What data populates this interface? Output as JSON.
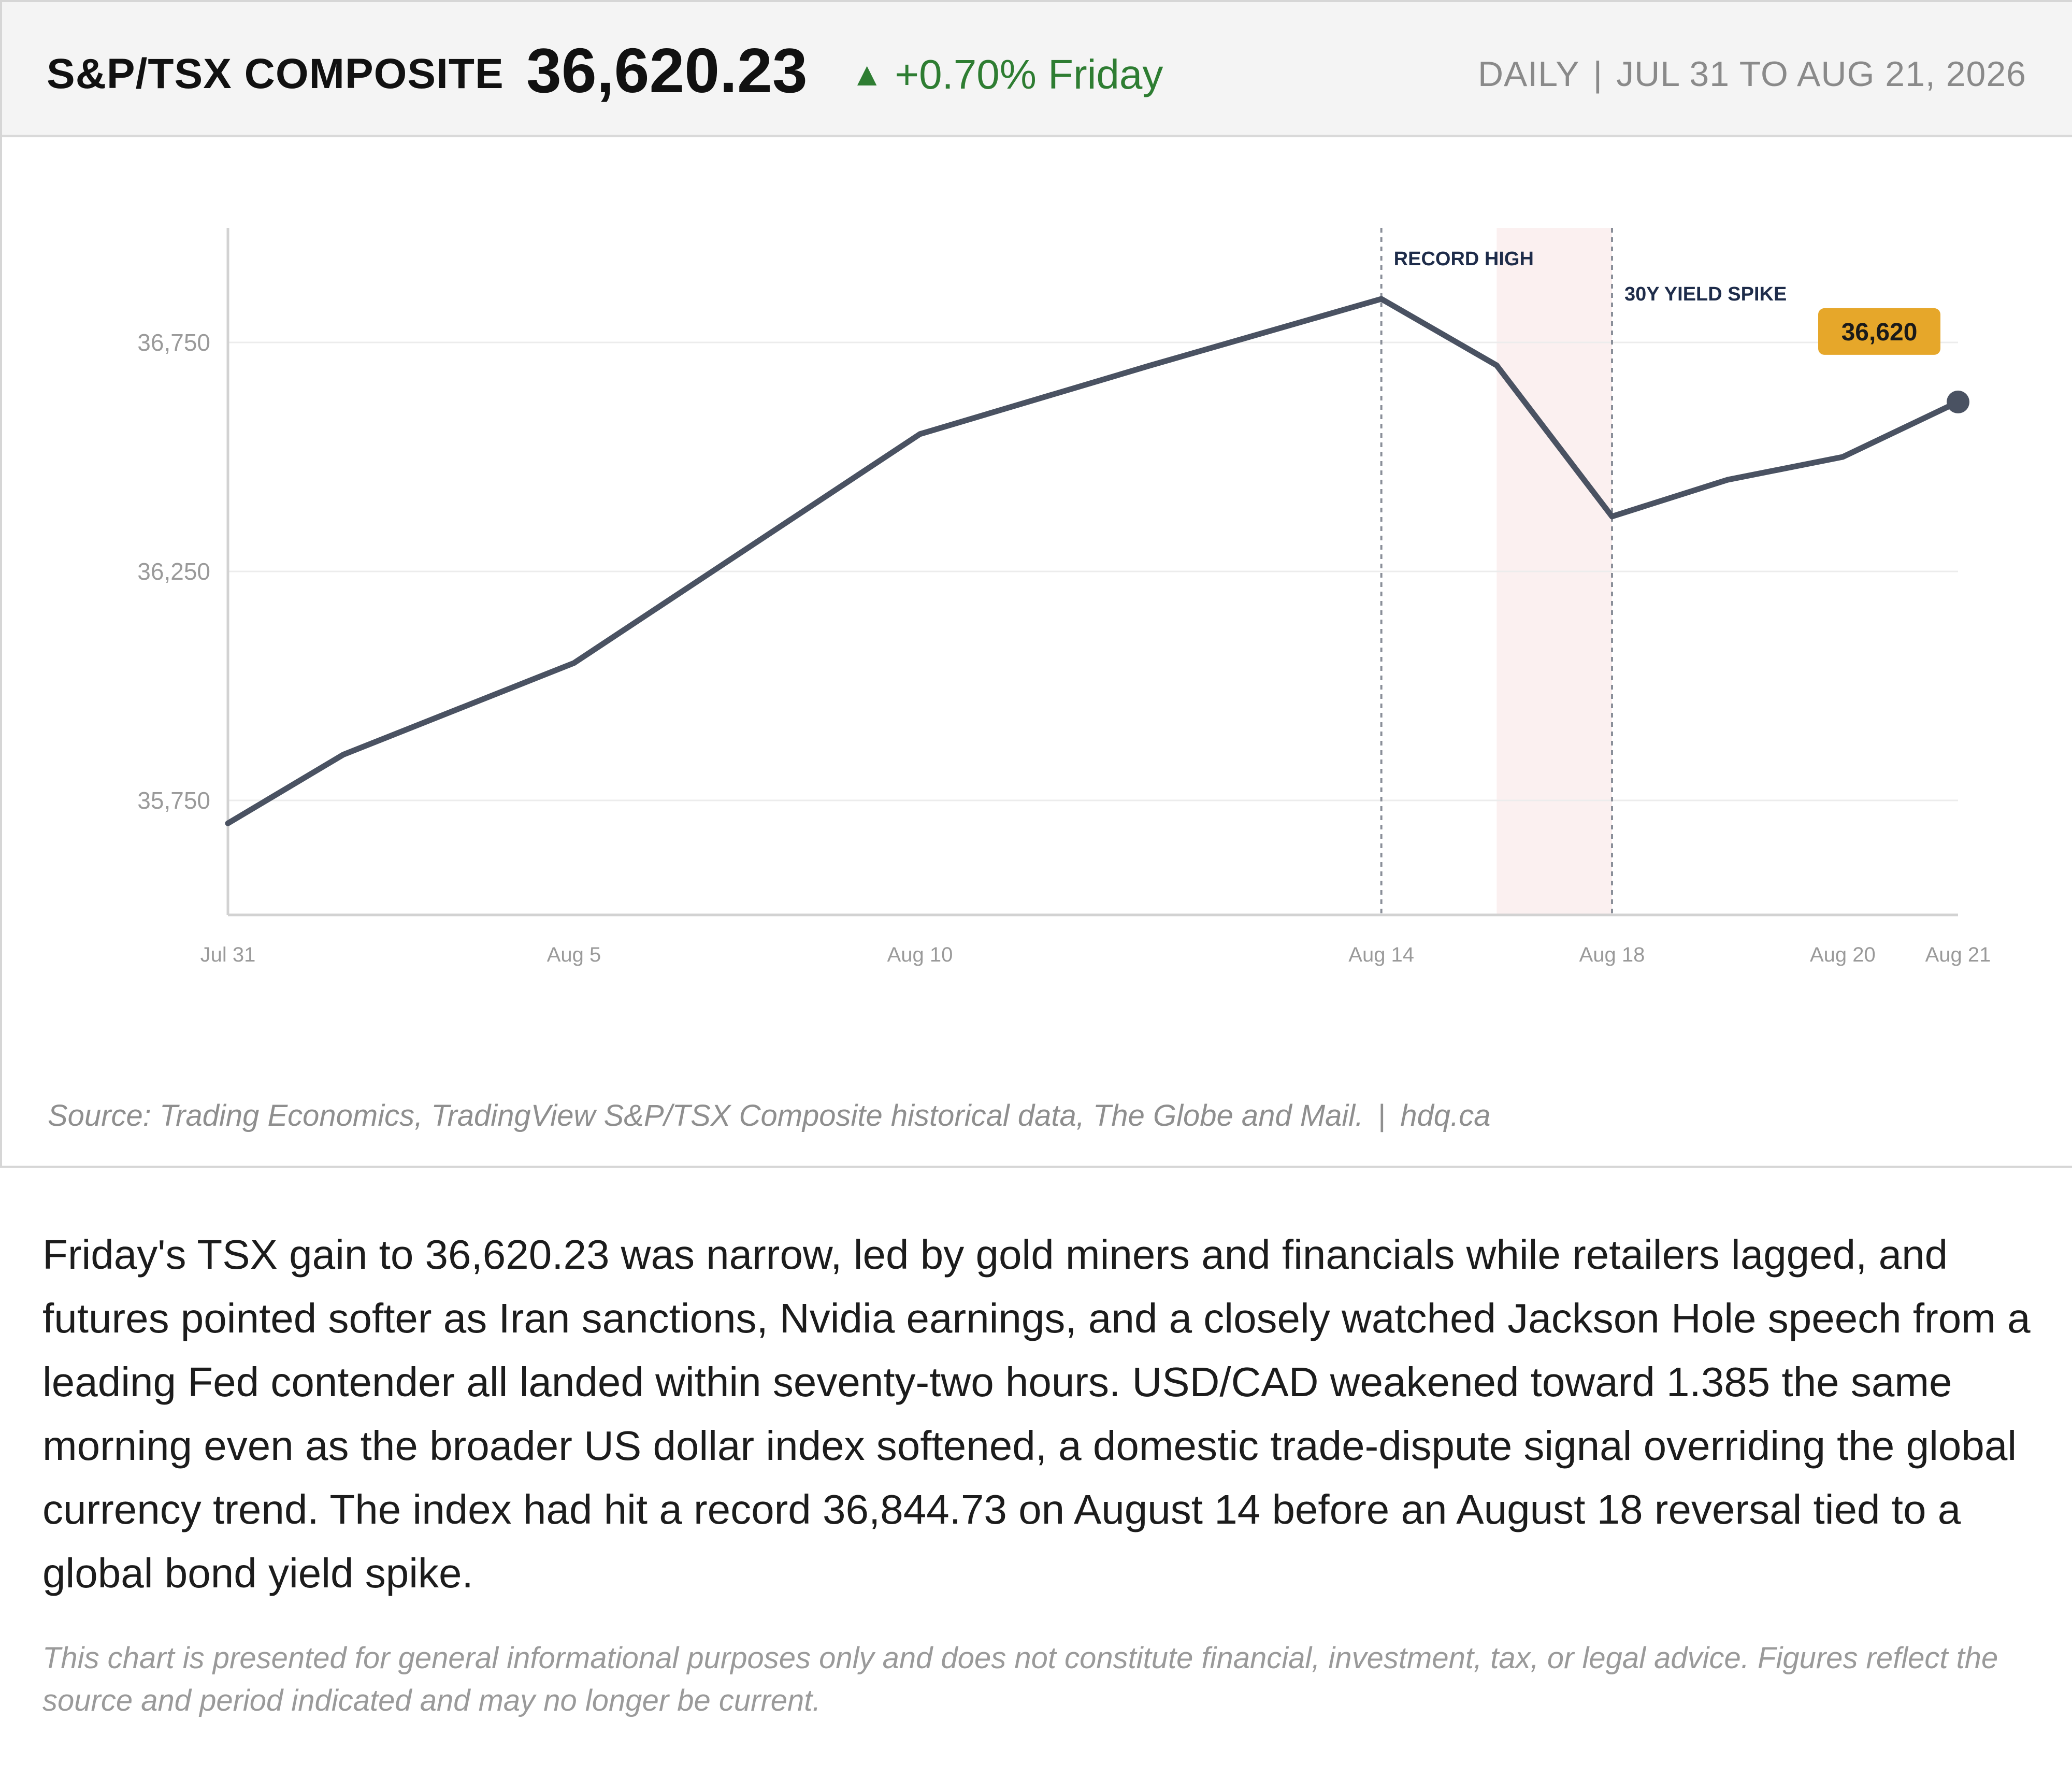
{
  "header": {
    "index_name": "S&P/TSX COMPOSITE",
    "value": "36,620.23",
    "change_arrow": "▲",
    "change": "+0.70% Friday",
    "frequency": "DAILY",
    "separator": "|",
    "range": "JUL 31 TO AUG 21, 2026"
  },
  "chart_data": {
    "type": "line",
    "x": [
      "Jul 31",
      "Aug 3",
      "Aug 5",
      "Aug 10",
      "Aug 12",
      "Aug 14",
      "Aug 17",
      "Aug 18",
      "Aug 19",
      "Aug 20",
      "Aug 21"
    ],
    "series": [
      {
        "values": [
          35700,
          35850,
          36050,
          36550,
          36700,
          36845,
          36700,
          36370,
          36450,
          36500,
          36620
        ]
      }
    ],
    "x_tick_labels": [
      "Jul 31",
      "Aug 5",
      "Aug 10",
      "Aug 14",
      "Aug 18",
      "Aug 20",
      "Aug 21"
    ],
    "y_ticks": [
      35750,
      36250,
      36750
    ],
    "y_tick_labels": [
      "35,750",
      "36,250",
      "36,750"
    ],
    "ylim": [
      35500,
      37000
    ],
    "grid": "horizontal",
    "annotations": [
      {
        "x": "Aug 14",
        "label": "RECORD HIGH"
      },
      {
        "x": "Aug 18",
        "label": "30Y YIELD SPIKE"
      }
    ],
    "shaded_range": [
      "Aug 17",
      "Aug 18"
    ],
    "last_value_label": "36,620",
    "colors": {
      "line": "#4a5262",
      "shade": "#fbf0f0",
      "badge": "#e6a72a",
      "annotation": "#1e2c4a"
    }
  },
  "footer": {
    "source": "Source: Trading Economics, TradingView S&P/TSX Composite historical data, The Globe and Mail.",
    "separator": "|",
    "site": "hdq.ca"
  },
  "commentary": "Friday's TSX gain to 36,620.23 was narrow, led by gold miners and financials while retailers lagged, and futures pointed softer as Iran sanctions, Nvidia earnings, and a closely watched Jackson Hole speech from a leading Fed contender all landed within seventy-two hours. USD/CAD weakened toward 1.385 the same morning even as the broader US dollar index softened, a domestic trade-dispute signal overriding the global currency trend. The index had hit a record 36,844.73 on August 14 before an August 18 reversal tied to a global bond yield spike.",
  "disclaimer": "This chart is presented for general informational purposes only and does not constitute financial, investment, tax, or legal advice. Figures reflect the source and period indicated and may no longer be current."
}
